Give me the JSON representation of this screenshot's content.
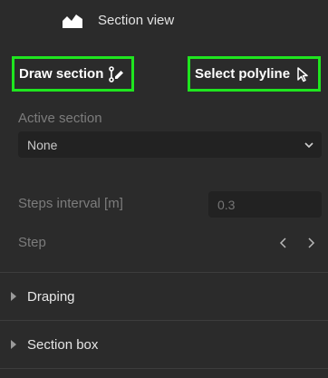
{
  "header": {
    "title": "Section view",
    "icon": "section-view-icon"
  },
  "actions": {
    "draw_section": {
      "label": "Draw section",
      "icon": "draw-polyline-pencil-icon"
    },
    "select_polyline": {
      "label": "Select polyline",
      "icon": "cursor-arrow-icon"
    }
  },
  "active_section": {
    "label": "Active section",
    "selected": "None"
  },
  "steps_interval": {
    "label": "Steps interval [m]",
    "placeholder": "0.3"
  },
  "step": {
    "label": "Step"
  },
  "sections": [
    {
      "label": "Draping"
    },
    {
      "label": "Section box"
    }
  ],
  "colors": {
    "highlight": "#1fe51f",
    "background": "#2b2b2b",
    "field": "#222222"
  }
}
